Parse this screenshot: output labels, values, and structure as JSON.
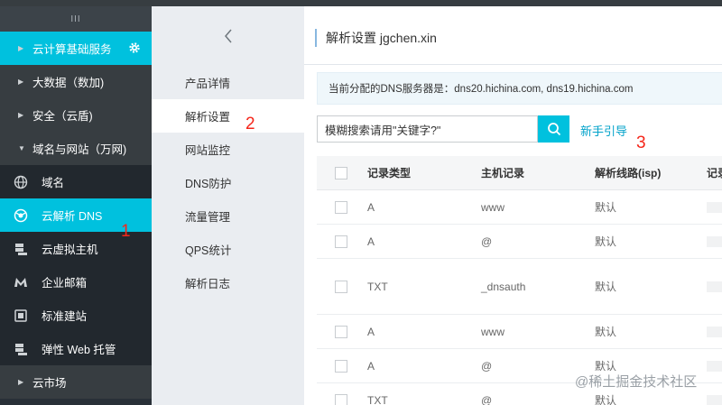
{
  "sidebar": {
    "handle": "III",
    "groups": [
      {
        "label": "云计算基础服务"
      },
      {
        "label": "大数据（数加)"
      },
      {
        "label": "安全（云盾)"
      },
      {
        "label": "域名与网站（万网)"
      }
    ],
    "items": [
      {
        "label": "域名",
        "icon": "globe-icon"
      },
      {
        "label": "云解析 DNS",
        "icon": "dns-icon"
      },
      {
        "label": "云虚拟主机",
        "icon": "server-icon"
      },
      {
        "label": "企业邮箱",
        "icon": "mail-icon"
      },
      {
        "label": "标准建站",
        "icon": "site-icon"
      },
      {
        "label": "弹性 Web 托管",
        "icon": "hosting-icon"
      }
    ],
    "bottom": {
      "label": "云市场"
    }
  },
  "subnav": {
    "items": [
      {
        "label": "产品详情"
      },
      {
        "label": "解析设置"
      },
      {
        "label": "网站监控"
      },
      {
        "label": "DNS防护"
      },
      {
        "label": "流量管理"
      },
      {
        "label": "QPS统计"
      },
      {
        "label": "解析日志"
      }
    ]
  },
  "main": {
    "title": "解析设置 jgchen.xin",
    "notice": "当前分配的DNS服务器是：dns20.hichina.com, dns19.hichina.com",
    "search_placeholder": "模糊搜索请用\"关键字?\"",
    "guide_link": "新手引导",
    "table": {
      "headers": [
        "记录类型",
        "主机记录",
        "解析线路(isp)",
        "记录"
      ],
      "rows": [
        {
          "type": "A",
          "host": "www",
          "line": "默认"
        },
        {
          "type": "A",
          "host": "@",
          "line": "默认"
        },
        {
          "type": "TXT",
          "host": "_dnsauth",
          "line": "默认"
        },
        {
          "type": "A",
          "host": "www",
          "line": "默认"
        },
        {
          "type": "A",
          "host": "@",
          "line": "默认"
        },
        {
          "type": "TXT",
          "host": "@",
          "line": "默认"
        }
      ]
    }
  },
  "annotations": [
    "1",
    "2",
    "3"
  ],
  "watermark": "@稀土掘金技术社区",
  "colors": {
    "accent": "#00c1de",
    "sidebar": "#293038",
    "annotation": "#f5261a",
    "link": "#00a2ca"
  }
}
